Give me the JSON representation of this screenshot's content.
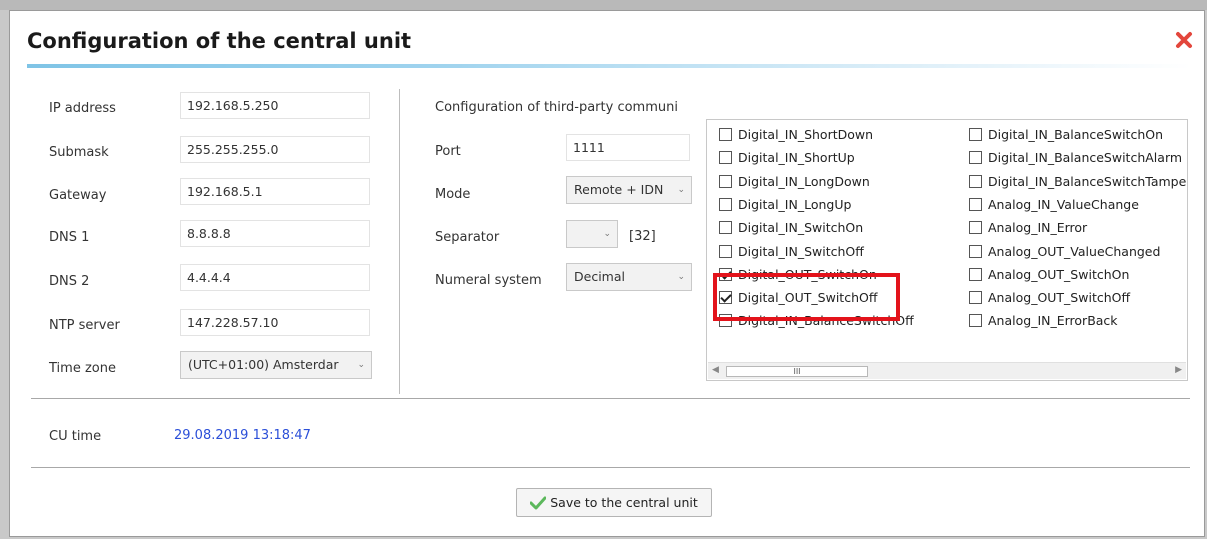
{
  "dialog": {
    "title": "Configuration of the central unit",
    "close_icon": "close-icon"
  },
  "network": {
    "ip_label": "IP address",
    "ip_value": "192.168.5.250",
    "submask_label": "Submask",
    "submask_value": "255.255.255.0",
    "gateway_label": "Gateway",
    "gateway_value": "192.168.5.1",
    "dns1_label": "DNS 1",
    "dns1_value": "8.8.8.8",
    "dns2_label": "DNS 2",
    "dns2_value": "4.4.4.4",
    "ntp_label": "NTP server",
    "ntp_value": "147.228.57.10",
    "timezone_label": "Time zone",
    "timezone_value": "(UTC+01:00) Amsterdar"
  },
  "third_party": {
    "heading": "Configuration of third-party communi",
    "port_label": "Port",
    "port_value": "1111",
    "mode_label": "Mode",
    "mode_value": "Remote + IDN",
    "separator_label": "Separator",
    "separator_value": "",
    "separator_code": "[32]",
    "numeral_label": "Numeral system",
    "numeral_value": "Decimal"
  },
  "events": {
    "col1": [
      {
        "label": "Digital_IN_ShortDown",
        "checked": false
      },
      {
        "label": "Digital_IN_ShortUp",
        "checked": false
      },
      {
        "label": "Digital_IN_LongDown",
        "checked": false
      },
      {
        "label": "Digital_IN_LongUp",
        "checked": false
      },
      {
        "label": "Digital_IN_SwitchOn",
        "checked": false
      },
      {
        "label": "Digital_IN_SwitchOff",
        "checked": false
      },
      {
        "label": "Digital_OUT_SwitchOn",
        "checked": true
      },
      {
        "label": "Digital_OUT_SwitchOff",
        "checked": true
      },
      {
        "label": "Digital_IN_BalanceSwitchOff",
        "checked": false
      }
    ],
    "col2": [
      {
        "label": "Digital_IN_BalanceSwitchOn",
        "checked": false
      },
      {
        "label": "Digital_IN_BalanceSwitchAlarm",
        "checked": false
      },
      {
        "label": "Digital_IN_BalanceSwitchTampe",
        "checked": false
      },
      {
        "label": "Analog_IN_ValueChange",
        "checked": false
      },
      {
        "label": "Analog_IN_Error",
        "checked": false
      },
      {
        "label": "Analog_OUT_ValueChanged",
        "checked": false
      },
      {
        "label": "Analog_OUT_SwitchOn",
        "checked": false
      },
      {
        "label": "Analog_OUT_SwitchOff",
        "checked": false
      },
      {
        "label": "Analog_IN_ErrorBack",
        "checked": false
      }
    ],
    "scroll_thumb_text": "III"
  },
  "cu_time": {
    "label": "CU time",
    "value": "29.08.2019 13:18:47"
  },
  "footer": {
    "save_label": "Save to the central unit",
    "save_icon": "checkmark-icon"
  },
  "colors": {
    "close": "#e3463c",
    "highlight": "#e3131b",
    "time_value": "#2b4fd8",
    "save_check": "#5cb85c"
  }
}
